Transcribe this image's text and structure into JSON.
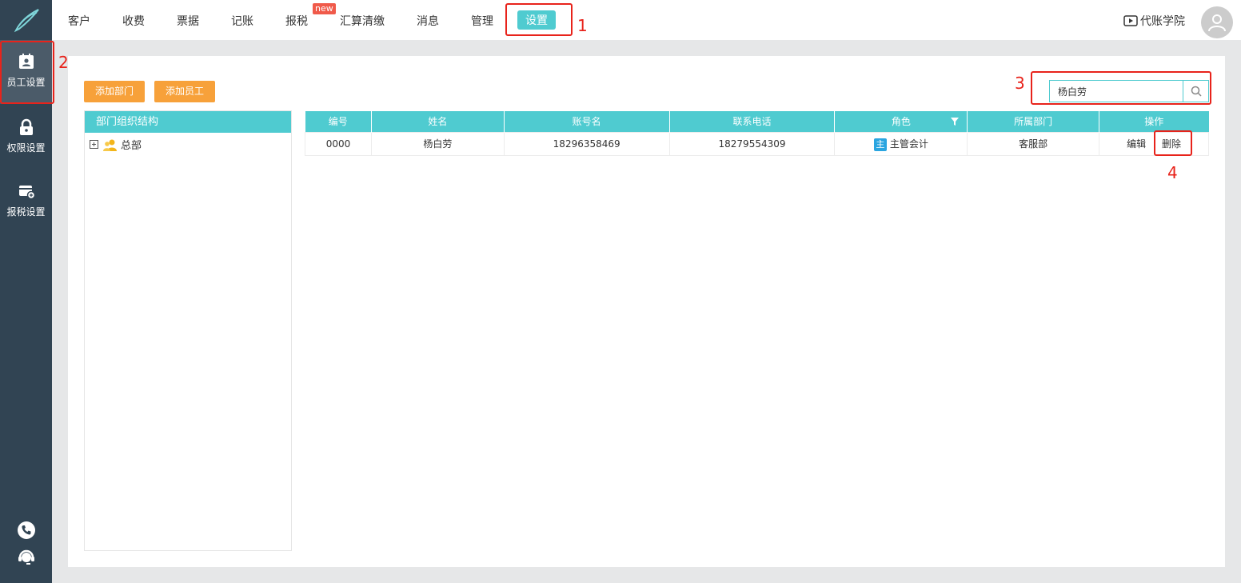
{
  "nav": {
    "items": [
      "客户",
      "收费",
      "票据",
      "记账",
      "报税",
      "汇算清缴",
      "消息",
      "管理"
    ],
    "active": "设置",
    "badge": "new",
    "academy": "代账学院"
  },
  "sidebar": {
    "items": [
      {
        "label": "员工设置",
        "icon": "employee-card-icon"
      },
      {
        "label": "权限设置",
        "icon": "lock-icon"
      },
      {
        "label": "报税设置",
        "icon": "tax-card-icon"
      }
    ]
  },
  "toolbar": {
    "add_dept": "添加部门",
    "add_staff": "添加员工"
  },
  "search": {
    "value": "杨白劳"
  },
  "tree": {
    "header": "部门组织结构",
    "root": "总部"
  },
  "table": {
    "headers": [
      "编号",
      "姓名",
      "账号名",
      "联系电话",
      "角色",
      "所属部门",
      "操作"
    ],
    "rows": [
      {
        "id": "0000",
        "name": "杨白劳",
        "account": "18296358469",
        "phone": "18279554309",
        "role_tag": "主",
        "role": "主管会计",
        "dept": "客服部",
        "edit": "编辑",
        "delete": "删除"
      }
    ]
  },
  "annotations": {
    "n1": "1",
    "n2": "2",
    "n3": "3",
    "n4": "4",
    "color": "#e8231b"
  },
  "colors": {
    "accent": "#4fcbd0",
    "sidebar": "#314453",
    "button": "#f7a13a"
  }
}
